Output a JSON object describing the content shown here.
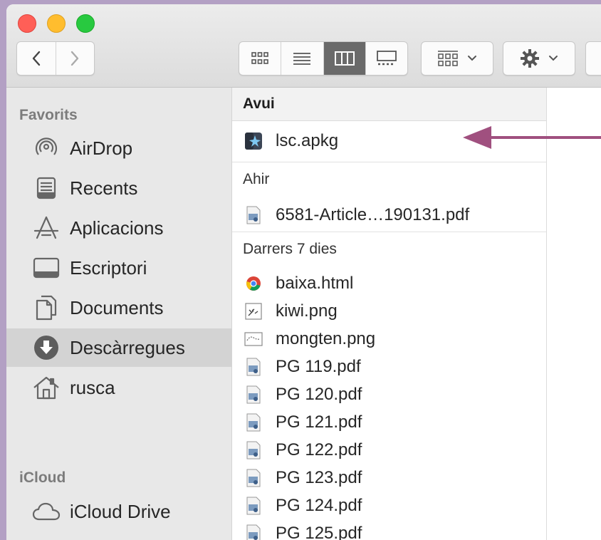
{
  "sidebar": {
    "favorites_heading": "Favorits",
    "favorites": [
      {
        "label": "AirDrop",
        "icon": "airdrop-icon"
      },
      {
        "label": "Recents",
        "icon": "recents-icon"
      },
      {
        "label": "Aplicacions",
        "icon": "applications-icon"
      },
      {
        "label": "Escriptori",
        "icon": "desktop-icon"
      },
      {
        "label": "Documents",
        "icon": "documents-icon"
      },
      {
        "label": "Descàrregues",
        "icon": "downloads-icon",
        "selected": true
      },
      {
        "label": "rusca",
        "icon": "home-icon"
      }
    ],
    "icloud_heading": "iCloud",
    "icloud": [
      {
        "label": "iCloud Drive",
        "icon": "cloud-icon"
      }
    ]
  },
  "column": {
    "sections": [
      {
        "title": "Avui",
        "files": [
          {
            "name": "lsc.apkg",
            "icon": "anki-icon"
          }
        ]
      },
      {
        "title": "Ahir",
        "files": [
          {
            "name": "6581-Article…190131.pdf",
            "icon": "pdf-icon"
          }
        ]
      },
      {
        "title": "Darrers 7 dies",
        "files": [
          {
            "name": "baixa.html",
            "icon": "chrome-icon"
          },
          {
            "name": "kiwi.png",
            "icon": "image-icon"
          },
          {
            "name": "mongten.png",
            "icon": "image-icon"
          },
          {
            "name": "PG 119.pdf",
            "icon": "pdf-icon"
          },
          {
            "name": "PG 120.pdf",
            "icon": "pdf-icon"
          },
          {
            "name": "PG 121.pdf",
            "icon": "pdf-icon"
          },
          {
            "name": "PG 122.pdf",
            "icon": "pdf-icon"
          },
          {
            "name": "PG 123.pdf",
            "icon": "pdf-icon"
          },
          {
            "name": "PG 124.pdf",
            "icon": "pdf-icon"
          },
          {
            "name": "PG 125.pdf",
            "icon": "pdf-icon"
          }
        ]
      }
    ]
  },
  "toolbar": {
    "view_modes": [
      "icon-view",
      "list-view",
      "column-view",
      "gallery-view"
    ],
    "active_view": "column-view"
  },
  "annotation": {
    "arrow_color": "#a0507f"
  },
  "colors": {
    "background": "#b3a0c4",
    "active_view": "#6a6a6a"
  }
}
